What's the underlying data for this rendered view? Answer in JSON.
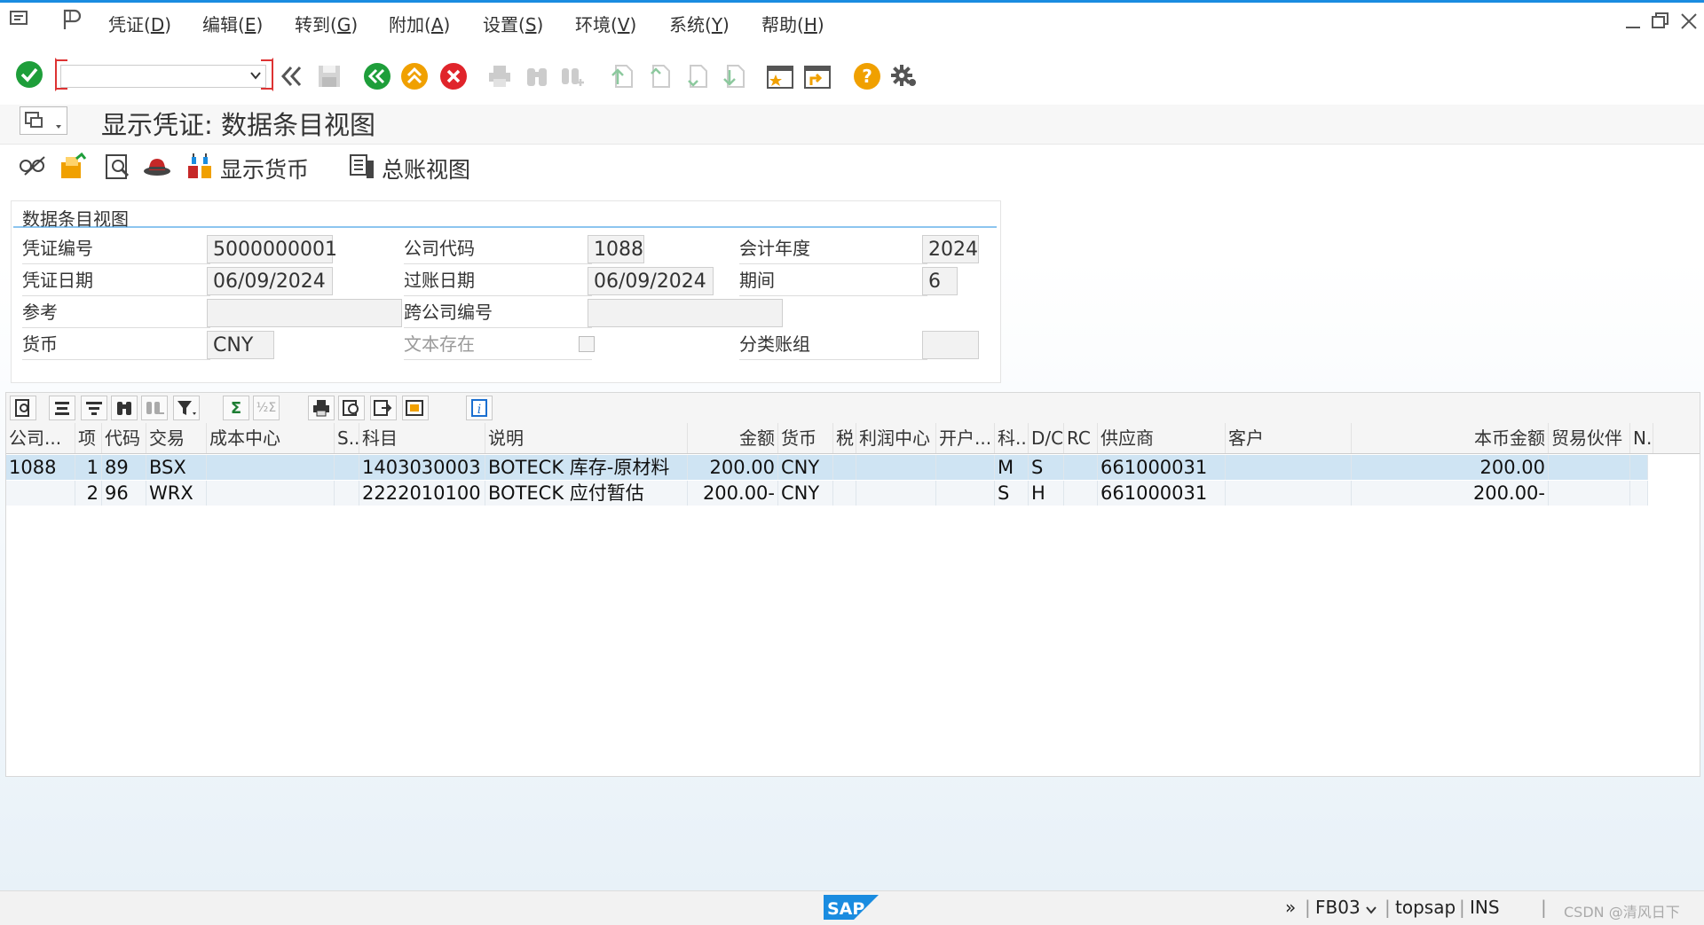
{
  "menu": {
    "items": [
      {
        "label": "凭证(",
        "key": "D",
        "end": ")"
      },
      {
        "label": "编辑(",
        "key": "E",
        "end": ")"
      },
      {
        "label": "转到(",
        "key": "G",
        "end": ")"
      },
      {
        "label": "附加(",
        "key": "A",
        "end": ")"
      },
      {
        "label": "设置(",
        "key": "S",
        "end": ")"
      },
      {
        "label": "环境(",
        "key": "V",
        "end": ")"
      },
      {
        "label": "系统(",
        "key": "Y",
        "end": ")"
      },
      {
        "label": "帮助(",
        "key": "H",
        "end": ")"
      }
    ]
  },
  "toolbar": {
    "command_value": ""
  },
  "title": "显示凭证: 数据条目视图",
  "app_toolbar": {
    "display_currency": "显示货币",
    "ledger_view": "总账视图"
  },
  "header": {
    "section_title": "数据条目视图",
    "doc_no_label": "凭证编号",
    "doc_no": "5000000001",
    "company_label": "公司代码",
    "company": "1088",
    "fiscal_year_label": "会计年度",
    "fiscal_year": "2024",
    "doc_date_label": "凭证日期",
    "doc_date": "06/09/2024",
    "post_date_label": "过账日期",
    "post_date": "06/09/2024",
    "period_label": "期间",
    "period": "6",
    "ref_label": "参考",
    "ref": "",
    "cross_label": "跨公司编号",
    "cross": "",
    "currency_label": "货币",
    "currency": "CNY",
    "text_exists_label": "文本存在",
    "ledger_group_label": "分类账组",
    "ledger_group": ""
  },
  "grid": {
    "columns": [
      "公司...",
      "项",
      "代码",
      "交易",
      "成本中心",
      "S...",
      "科目",
      "说明",
      "金额",
      "货币",
      "税",
      "利润中心",
      "开户...",
      "科...",
      "D/C",
      "RC",
      "供应商",
      "客户",
      "本币金额",
      "贸易伙伴",
      "N..."
    ],
    "rows": [
      {
        "company": "1088",
        "item": "1",
        "code": "89",
        "trans": "BSX",
        "cc": "",
        "s": "",
        "account": "1403030003",
        "desc": "BOTECK 库存-原材料",
        "amount": "200.00",
        "curr": "CNY",
        "tax": "",
        "pc": "",
        "bank": "",
        "acct_type": "M",
        "dc": "S",
        "rc": "",
        "vendor": "661000031",
        "customer": "",
        "local_amt": "200.00",
        "partner": "",
        "n": ""
      },
      {
        "company": "",
        "item": "2",
        "code": "96",
        "trans": "WRX",
        "cc": "",
        "s": "",
        "account": "2222010100",
        "desc": "BOTECK 应付暂估",
        "amount": "200.00-",
        "curr": "CNY",
        "tax": "",
        "pc": "",
        "bank": "",
        "acct_type": "S",
        "dc": "H",
        "rc": "",
        "vendor": "661000031",
        "customer": "",
        "local_amt": "200.00-",
        "partner": "",
        "n": ""
      }
    ]
  },
  "status": {
    "tcode": "FB03",
    "system": "topsap",
    "mode": "INS",
    "watermark": "CSDN @清风日下"
  },
  "colors": {
    "accent": "#1a8ce0",
    "ok_green": "#1e9e3a",
    "nav_green": "#1e9e3a",
    "nav_orange": "#f0a000",
    "cancel_red": "#e0242b",
    "help_orange": "#f0a000"
  }
}
